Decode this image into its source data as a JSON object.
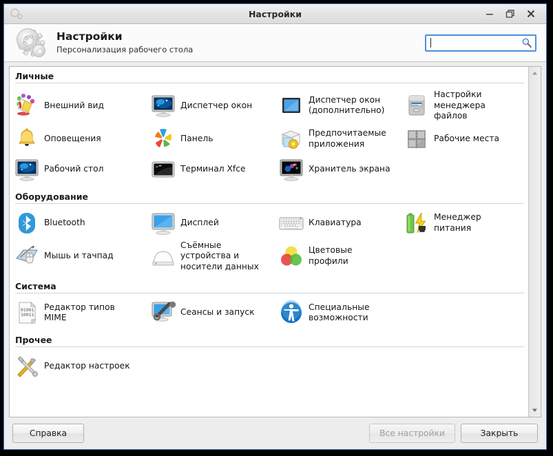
{
  "window": {
    "title": "Настройки",
    "titlebar_icon": "settings-gears-icon",
    "minimize_label": "−",
    "maximize_label": "❐",
    "close_label": "✕"
  },
  "header": {
    "icon": "settings-gears-icon",
    "title": "Настройки",
    "subtitle": "Персонализация рабочего стола",
    "search": {
      "value": "",
      "placeholder": "",
      "icon": "search-icon"
    }
  },
  "sections": [
    {
      "id": "personal",
      "title": "Личные",
      "items": [
        {
          "label": "Внешний вид",
          "icon": "appearance-icon"
        },
        {
          "label": "Диспетчер окон",
          "icon": "window-manager-icon"
        },
        {
          "label": "Диспетчер окон (дополнительно)",
          "icon": "window-manager-tweaks-icon"
        },
        {
          "label": "Настройки менеджера файлов",
          "icon": "file-manager-icon"
        },
        {
          "label": "Оповещения",
          "icon": "notification-bell-icon"
        },
        {
          "label": "Панель",
          "icon": "panel-icon"
        },
        {
          "label": "Предпочитаемые приложения",
          "icon": "preferred-applications-icon"
        },
        {
          "label": "Рабочие места",
          "icon": "workspaces-icon"
        },
        {
          "label": "Рабочий стол",
          "icon": "desktop-icon"
        },
        {
          "label": "Терминал Xfce",
          "icon": "terminal-icon"
        },
        {
          "label": "Хранитель экрана",
          "icon": "screensaver-icon"
        }
      ]
    },
    {
      "id": "hardware",
      "title": "Оборудование",
      "items": [
        {
          "label": "Bluetooth",
          "icon": "bluetooth-icon"
        },
        {
          "label": "Дисплей",
          "icon": "display-icon"
        },
        {
          "label": "Клавиатура",
          "icon": "keyboard-icon"
        },
        {
          "label": "Менеджер питания",
          "icon": "power-manager-icon"
        },
        {
          "label": "Мышь и тачпад",
          "icon": "mouse-touchpad-icon"
        },
        {
          "label": "Съёмные устройства и носители данных",
          "icon": "removable-drive-icon"
        },
        {
          "label": "Цветовые профили",
          "icon": "color-profiles-icon"
        }
      ]
    },
    {
      "id": "system",
      "title": "Система",
      "items": [
        {
          "label": "Редактор типов MIME",
          "icon": "mime-type-editor-icon"
        },
        {
          "label": "Сеансы и запуск",
          "icon": "sessions-startup-icon"
        },
        {
          "label": "Специальные возможности",
          "icon": "accessibility-icon"
        }
      ]
    },
    {
      "id": "other",
      "title": "Прочее",
      "items": [
        {
          "label": "Редактор настроек",
          "icon": "settings-editor-icon"
        }
      ]
    }
  ],
  "scrollbar": {
    "up_arrow": "scroll-up-icon",
    "down_arrow": "scroll-down-icon"
  },
  "buttons": {
    "help": "Справка",
    "all_settings": "Все настройки",
    "close": "Закрыть",
    "all_settings_disabled": true
  },
  "colors": {
    "window_border": "#3a76c4",
    "search_focus": "#4a8fe0",
    "content_bg": "#ffffff",
    "chrome_bg": "#ededed"
  }
}
